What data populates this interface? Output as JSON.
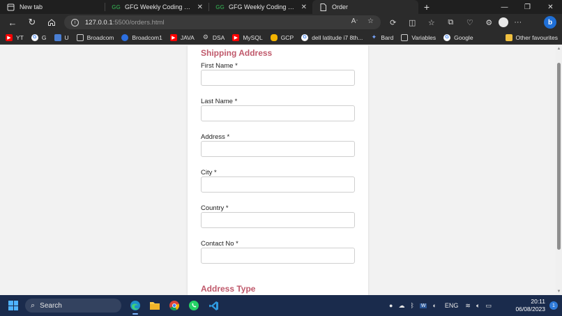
{
  "browser": {
    "tabs": [
      {
        "label": "New tab",
        "icon": "page-icon",
        "active": false
      },
      {
        "label": "GFG Weekly Coding Contest",
        "icon": "gfg-icon",
        "active": false
      },
      {
        "label": "GFG Weekly Coding Contest - 11",
        "icon": "gfg-icon",
        "active": false
      },
      {
        "label": "Order",
        "icon": "document-icon",
        "active": true
      }
    ],
    "address": {
      "host": "127.0.0.1",
      "path": ":5500/orders.html"
    },
    "bookmarks": [
      {
        "label": "YT",
        "icon": "youtube-icon",
        "color": "#ff0000"
      },
      {
        "label": "G",
        "icon": "google-icon",
        "color": "#ffffff"
      },
      {
        "label": "U",
        "icon": "screen-icon",
        "color": "#4a7fd4"
      },
      {
        "label": "Broadcom",
        "icon": "document-icon",
        "color": "#cccccc"
      },
      {
        "label": "Broadcom1",
        "icon": "broadcom-icon",
        "color": "#2c6fe0"
      },
      {
        "label": "JAVA",
        "icon": "youtube-icon",
        "color": "#ff0000"
      },
      {
        "label": "DSA",
        "icon": "gear-icon",
        "color": "#cccccc"
      },
      {
        "label": "MySQL",
        "icon": "youtube-icon",
        "color": "#ff0000"
      },
      {
        "label": "GCP",
        "icon": "cloud-icon",
        "color": "#f4b400"
      },
      {
        "label": "dell latitude i7 8th...",
        "icon": "google-icon",
        "color": "#ffffff"
      },
      {
        "label": "Bard",
        "icon": "sparkle-icon",
        "color": "#7aa7ff"
      },
      {
        "label": "Variables",
        "icon": "document-icon",
        "color": "#cccccc"
      },
      {
        "label": "Google",
        "icon": "google-icon",
        "color": "#ffffff"
      }
    ],
    "favourites_label": "Other favourites"
  },
  "form": {
    "accent": "#c0596b",
    "shipping_title": "Shipping Address",
    "fields": [
      {
        "label": "First Name *"
      },
      {
        "label": "Last Name *"
      },
      {
        "label": "Address *"
      },
      {
        "label": "City *"
      },
      {
        "label": "Country *"
      },
      {
        "label": "Contact No *"
      }
    ],
    "address_type_title": "Address Type"
  },
  "taskbar": {
    "search_label": "Search",
    "language": "ENG",
    "time": "20:11",
    "date": "06/08/2023",
    "notifications": "1"
  }
}
